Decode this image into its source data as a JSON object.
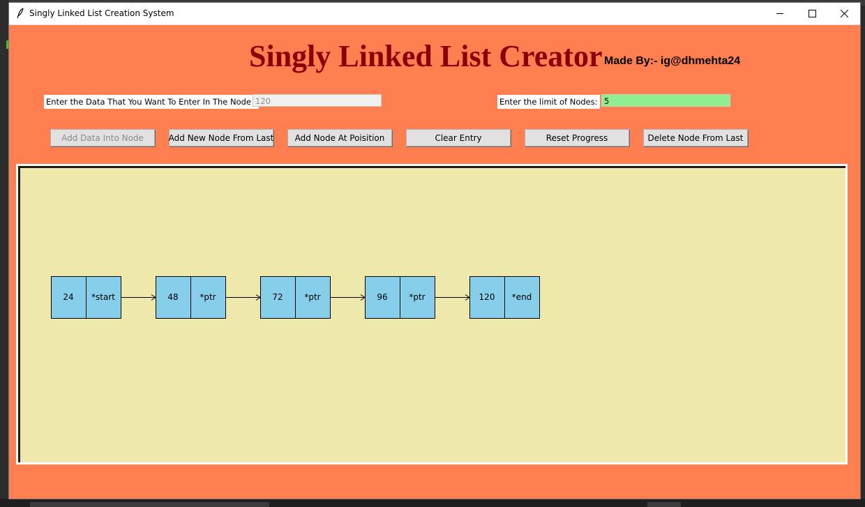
{
  "window": {
    "title": "Singly Linked List Creation System"
  },
  "app": {
    "title": "Singly Linked List Creator",
    "made_by": "Made By:-  ig@dhmehta24"
  },
  "inputs": {
    "data_label": "Enter the Data That You  Want To Enter In The Node :",
    "data_value": "120",
    "limit_label": "Enter the limit of Nodes:",
    "limit_value": "5"
  },
  "buttons": {
    "add_data": "Add Data Into Node",
    "add_new_last": "Add New Node From Last",
    "add_at_position": "Add Node At Poisition",
    "clear_entry": "Clear Entry",
    "reset_progress": "Reset Progress",
    "delete_last": "Delete Node From Last"
  },
  "list": {
    "nodes": [
      {
        "value": "24",
        "pointer": "*start"
      },
      {
        "value": "48",
        "pointer": "*ptr"
      },
      {
        "value": "72",
        "pointer": "*ptr"
      },
      {
        "value": "96",
        "pointer": "*ptr"
      },
      {
        "value": "120",
        "pointer": "*end"
      }
    ]
  },
  "colors": {
    "window_bg": "#ff7f50",
    "title_color": "#8b0000",
    "canvas_bg": "#eee8aa",
    "node_fill": "#87ceeb",
    "limit_entry_bg": "#90ee90"
  }
}
